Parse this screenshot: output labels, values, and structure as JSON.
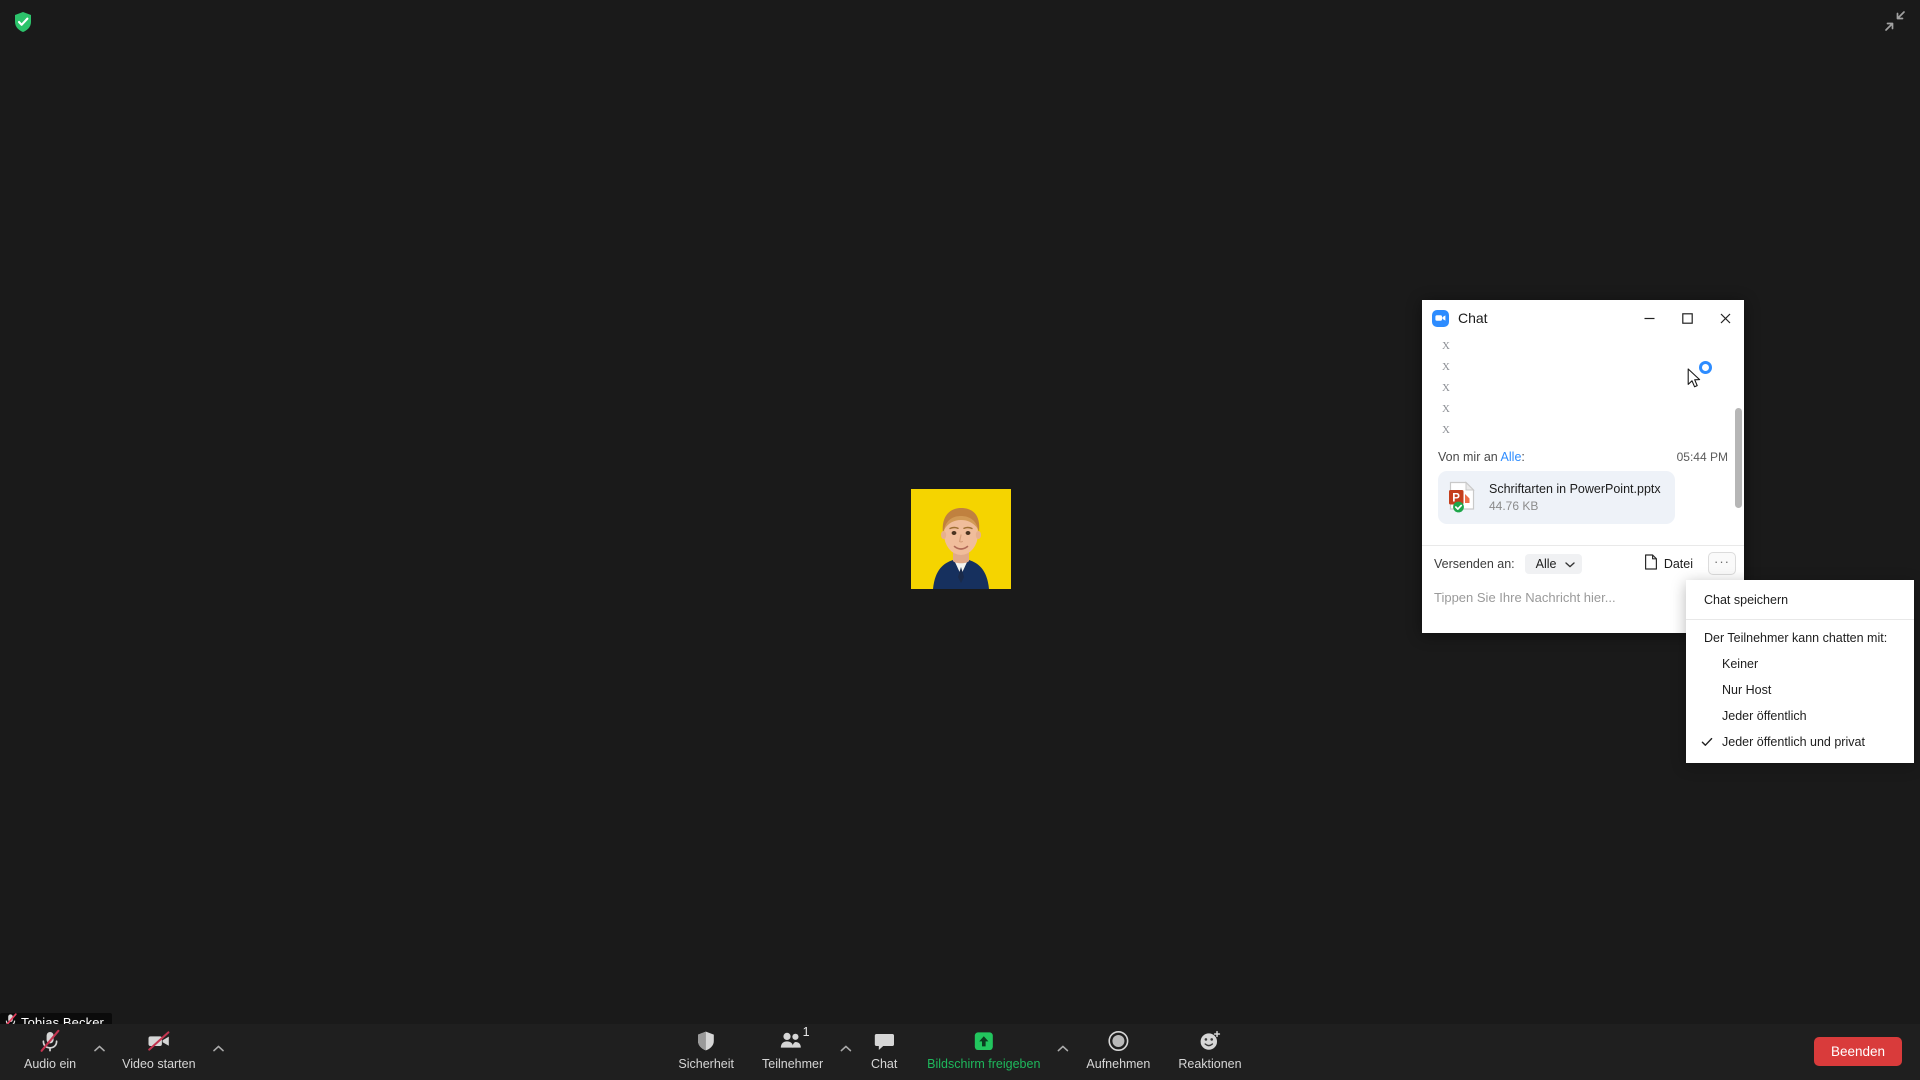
{
  "app": {
    "background_color": "#1a1a1a",
    "encryption_icon": "shield-check-icon",
    "exit_fullscreen_icon": "exit-fullscreen-icon"
  },
  "stage": {
    "participant_name": "Tobias Becker",
    "nametag_mic_icon": "mic-muted-icon",
    "video_tile": {
      "background_color": "#f5d400",
      "alt": "participant-profile-photo"
    }
  },
  "toolbar": {
    "background_color": "#1f1f1f",
    "left_controls": [
      {
        "label": "Audio ein",
        "icon": "mic-muted-icon",
        "has_caret": true,
        "caret_icon": "chevron-up-icon"
      },
      {
        "label": "Video starten",
        "icon": "video-muted-icon",
        "has_caret": true,
        "caret_icon": "chevron-up-icon"
      }
    ],
    "center_controls": [
      {
        "label": "Sicherheit",
        "icon": "shield-icon",
        "has_caret": false,
        "badge": ""
      },
      {
        "label": "Teilnehmer",
        "icon": "participants-icon",
        "has_caret": true,
        "caret_icon": "chevron-up-icon",
        "badge": "1"
      },
      {
        "label": "Chat",
        "icon": "chat-bubble-icon",
        "has_caret": false,
        "badge": ""
      },
      {
        "label": "Bildschirm freigeben",
        "icon": "share-screen-icon",
        "has_caret": true,
        "caret_icon": "chevron-up-icon",
        "badge": "",
        "accent_color": "#1eb85c"
      },
      {
        "label": "Aufnehmen",
        "icon": "record-icon",
        "has_caret": false,
        "badge": ""
      },
      {
        "label": "Reaktionen",
        "icon": "reactions-icon",
        "has_caret": false,
        "badge": ""
      }
    ],
    "end_button": {
      "label": "Beenden",
      "color": "#d93b3b"
    }
  },
  "chat_window": {
    "title": "Chat",
    "logo_icon": "zoom-video-logo-icon",
    "window_controls": {
      "minimize_icon": "minimize-icon",
      "maximize_icon": "maximize-icon",
      "close_icon": "close-icon"
    },
    "placeholder_lines": [
      "X",
      "X",
      "X",
      "X",
      "X"
    ],
    "spinner_icon": "loading-spinner-icon",
    "cursor_icon": "mouse-pointer-icon",
    "message": {
      "from_prefix": "Von mir an ",
      "recipient": "Alle",
      "suffix": ":",
      "time": "05:44 PM",
      "attachment": {
        "file_name": "Schriftarten in PowerPoint.pptx",
        "file_size": "44.76 KB",
        "file_icon": "powerpoint-file-icon",
        "status_icon": "check-circle-icon"
      }
    },
    "send_row": {
      "send_to_label": "Versenden an:",
      "recipient_value": "Alle",
      "recipient_caret_icon": "chevron-down-icon",
      "file_button_label": "Datei",
      "file_button_icon": "document-icon",
      "more_button_label": "···",
      "more_button_icon": "more-options-icon"
    },
    "compose_placeholder": "Tippen Sie Ihre Nachricht hier..."
  },
  "context_menu": {
    "save_chat_label": "Chat speichern",
    "permission_heading": "Der Teilnehmer kann chatten mit:",
    "options": [
      {
        "label": "Keiner",
        "checked": false
      },
      {
        "label": "Nur Host",
        "checked": false
      },
      {
        "label": "Jeder öffentlich",
        "checked": false
      },
      {
        "label": "Jeder öffentlich und privat",
        "checked": true
      }
    ],
    "check_icon": "checkmark-icon"
  }
}
